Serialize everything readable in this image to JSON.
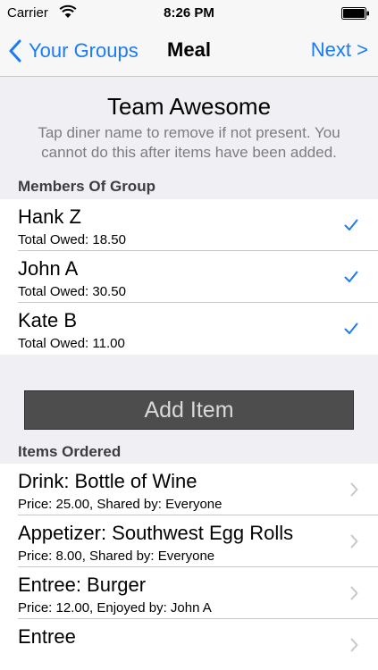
{
  "status_bar": {
    "carrier": "Carrier",
    "time": "8:26 PM",
    "wifi_icon": "wifi-icon",
    "battery_icon": "battery-icon"
  },
  "nav": {
    "back_label": "Your Groups",
    "title": "Meal",
    "next_label": "Next >"
  },
  "group": {
    "name": "Team Awesome",
    "instructions": "Tap diner name to remove if not present. You cannot do this after items have been added."
  },
  "members": {
    "header": "Members Of Group",
    "items": [
      {
        "name": "Hank Z",
        "owed": "Total Owed: 18.50",
        "checked": true
      },
      {
        "name": "John A",
        "owed": "Total Owed: 30.50",
        "checked": true
      },
      {
        "name": "Kate B",
        "owed": "Total Owed: 11.00",
        "checked": true
      }
    ]
  },
  "add_item_label": "Add Item",
  "items_ordered": {
    "header": "Items Ordered",
    "items": [
      {
        "title": "Drink: Bottle of Wine",
        "detail": "Price: 25.00, Shared by: Everyone"
      },
      {
        "title": "Appetizer: Southwest Egg Rolls",
        "detail": "Price: 8.00, Shared by: Everyone"
      },
      {
        "title": "Entree: Burger",
        "detail": "Price: 12.00, Enjoyed by: John A"
      },
      {
        "title": "Entree",
        "detail": ""
      }
    ]
  },
  "colors": {
    "accent": "#1a7cf4",
    "background": "#efeff4",
    "button": "#4d4d4d"
  }
}
